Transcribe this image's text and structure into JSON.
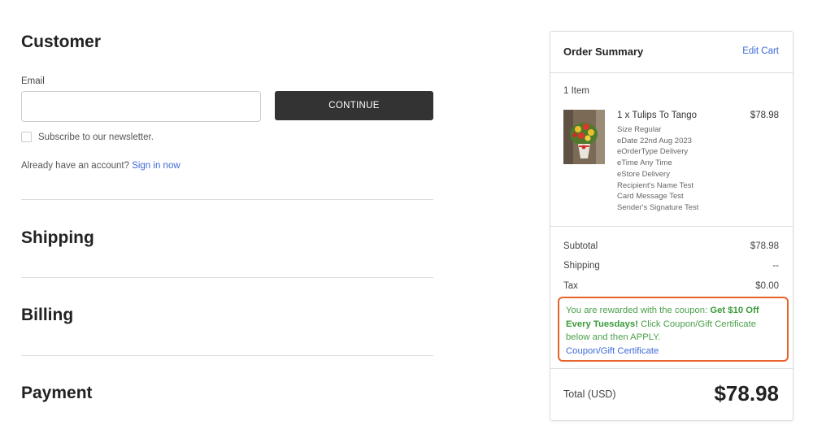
{
  "customer": {
    "title": "Customer",
    "email_label": "Email",
    "email_value": "",
    "email_placeholder": "",
    "continue_label": "CONTINUE",
    "newsletter_label": "Subscribe to our newsletter.",
    "account_prompt": "Already have an account?",
    "sign_in_label": "Sign in now"
  },
  "sections": {
    "shipping": "Shipping",
    "billing": "Billing",
    "payment": "Payment"
  },
  "summary": {
    "title": "Order Summary",
    "edit_cart": "Edit Cart",
    "items_count": "1 Item",
    "product": {
      "name": "1 x Tulips To Tango",
      "price": "$78.98",
      "options": [
        "Size Regular",
        "eDate 22nd Aug 2023",
        "eOrderType Delivery",
        "eTime Any Time",
        "eStore Delivery",
        "Recipient's Name Test",
        "Card Message Test",
        "Sender's Signature Test"
      ]
    },
    "subtotal_label": "Subtotal",
    "subtotal_value": "$78.98",
    "shipping_label": "Shipping",
    "shipping_value": "--",
    "tax_label": "Tax",
    "tax_value": "$0.00",
    "coupon": {
      "text_before": "You are rewarded with the coupon: ",
      "highlight": "Get $10 Off Every Tuesdays!",
      "text_after": " Click Coupon/Gift Certificate below and then APPLY.",
      "link": "Coupon/Gift Certificate"
    },
    "total_label": "Total (USD)",
    "total_value": "$78.98"
  },
  "colors": {
    "accent_link": "#3d6ad6",
    "button_bg": "#333333",
    "coupon_green": "#4aa04a",
    "highlight_border": "#e8622a"
  }
}
